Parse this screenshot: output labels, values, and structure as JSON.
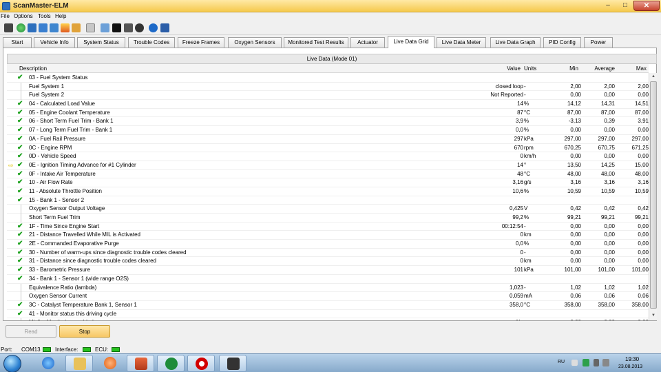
{
  "window": {
    "title": "ScanMaster-ELM",
    "min": "–",
    "max": "□",
    "close": "✕"
  },
  "menu": [
    "File",
    "Options",
    "Tools",
    "Help"
  ],
  "tabs": [
    "Start",
    "Vehicle Info",
    "System Status",
    "Trouble Codes",
    "Freeze Frames",
    "Oxygen Sensors",
    "Monitored Test Results",
    "Actuator",
    "Live Data Grid",
    "Live Data Meter",
    "Live Data Graph",
    "PID Config",
    "Power"
  ],
  "active_tab": "Live Data Grid",
  "panel_title": "Live Data (Mode 01)",
  "columns": {
    "description": "Description",
    "value": "Value",
    "units": "Units",
    "min": "Min",
    "average": "Average",
    "max": "Max"
  },
  "rows": [
    {
      "d": "03 - Fuel System Status",
      "v": "",
      "u": "",
      "mn": "",
      "av": "",
      "mx": "",
      "icon": "check",
      "indent": false
    },
    {
      "d": "Fuel System 1",
      "v": "closed loop",
      "u": "-",
      "mn": "2,00",
      "av": "2,00",
      "mx": "2,00",
      "icon": "",
      "indent": true
    },
    {
      "d": "Fuel System 2",
      "v": "Not Reported",
      "u": "-",
      "mn": "0,00",
      "av": "0,00",
      "mx": "0,00",
      "icon": "",
      "indent": true
    },
    {
      "d": "04 - Calculated Load Value",
      "v": "14",
      "u": "%",
      "mn": "14,12",
      "av": "14,31",
      "mx": "14,51",
      "icon": "check",
      "indent": false
    },
    {
      "d": "05 - Engine Coolant Temperature",
      "v": "87",
      "u": "°C",
      "mn": "87,00",
      "av": "87,00",
      "mx": "87,00",
      "icon": "check",
      "indent": false
    },
    {
      "d": "06 - Short Term Fuel Trim - Bank 1",
      "v": "3,9",
      "u": "%",
      "mn": "-3,13",
      "av": "0,39",
      "mx": "3,91",
      "icon": "check",
      "indent": false
    },
    {
      "d": "07 - Long Term Fuel Trim - Bank 1",
      "v": "0,0",
      "u": "%",
      "mn": "0,00",
      "av": "0,00",
      "mx": "0,00",
      "icon": "check",
      "indent": false
    },
    {
      "d": "0A - Fuel Rail Pressure",
      "v": "297",
      "u": "kPa",
      "mn": "297,00",
      "av": "297,00",
      "mx": "297,00",
      "icon": "check",
      "indent": false
    },
    {
      "d": "0C - Engine RPM",
      "v": "670",
      "u": "rpm",
      "mn": "670,25",
      "av": "670,75",
      "mx": "671,25",
      "icon": "check",
      "indent": false
    },
    {
      "d": "0D - Vehicle Speed",
      "v": "0",
      "u": "km/h",
      "mn": "0,00",
      "av": "0,00",
      "mx": "0,00",
      "icon": "check",
      "indent": false
    },
    {
      "d": "0E - Ignition Timing Advance for #1 Cylinder",
      "v": "14",
      "u": "°",
      "mn": "13,50",
      "av": "14,25",
      "mx": "15,00",
      "icon": "check",
      "indent": false,
      "arrow": "⇨"
    },
    {
      "d": "0F - Intake Air Temperature",
      "v": "48",
      "u": "°C",
      "mn": "48,00",
      "av": "48,00",
      "mx": "48,00",
      "icon": "check",
      "indent": false
    },
    {
      "d": "10 - Air Flow Rate",
      "v": "3,16",
      "u": "g/s",
      "mn": "3,16",
      "av": "3,16",
      "mx": "3,16",
      "icon": "check",
      "indent": false
    },
    {
      "d": "11 - Absolute Throttle Position",
      "v": "10,6",
      "u": "%",
      "mn": "10,59",
      "av": "10,59",
      "mx": "10,59",
      "icon": "check",
      "indent": false
    },
    {
      "d": "15 - Bank 1 - Sensor 2",
      "v": "",
      "u": "",
      "mn": "",
      "av": "",
      "mx": "",
      "icon": "check",
      "indent": false
    },
    {
      "d": "Oxygen Sensor Output Voltage",
      "v": "0,425",
      "u": "V",
      "mn": "0,42",
      "av": "0,42",
      "mx": "0,42",
      "icon": "",
      "indent": true
    },
    {
      "d": "Short Term Fuel Trim",
      "v": "99,2",
      "u": "%",
      "mn": "99,21",
      "av": "99,21",
      "mx": "99,21",
      "icon": "",
      "indent": true
    },
    {
      "d": "1F - Time Since Engine Start",
      "v": "00:12:54",
      "u": "-",
      "mn": "0,00",
      "av": "0,00",
      "mx": "0,00",
      "icon": "check",
      "indent": false
    },
    {
      "d": "21 - Distance Travelled While MIL is Activated",
      "v": "0",
      "u": "km",
      "mn": "0,00",
      "av": "0,00",
      "mx": "0,00",
      "icon": "check",
      "indent": false
    },
    {
      "d": "2E - Commanded Evaporative Purge",
      "v": "0,0",
      "u": "%",
      "mn": "0,00",
      "av": "0,00",
      "mx": "0,00",
      "icon": "check",
      "indent": false
    },
    {
      "d": "30 - Number of warm-ups since diagnostic trouble codes cleared",
      "v": "0",
      "u": "-",
      "mn": "0,00",
      "av": "0,00",
      "mx": "0,00",
      "icon": "check",
      "indent": false
    },
    {
      "d": "31 - Distance since diagnostic trouble codes cleared",
      "v": "0",
      "u": "km",
      "mn": "0,00",
      "av": "0,00",
      "mx": "0,00",
      "icon": "check",
      "indent": false
    },
    {
      "d": "33 - Barometric Pressure",
      "v": "101",
      "u": "kPa",
      "mn": "101,00",
      "av": "101,00",
      "mx": "101,00",
      "icon": "check",
      "indent": false
    },
    {
      "d": "34 - Bank 1 - Sensor 1 (wide range O2S)",
      "v": "",
      "u": "",
      "mn": "",
      "av": "",
      "mx": "",
      "icon": "check",
      "indent": false
    },
    {
      "d": "Equivalence Ratio (lambda)",
      "v": "1,023",
      "u": "-",
      "mn": "1,02",
      "av": "1,02",
      "mx": "1,02",
      "icon": "",
      "indent": true
    },
    {
      "d": "Oxygen Sensor Current",
      "v": "0,059",
      "u": "mA",
      "mn": "0,06",
      "av": "0,06",
      "mx": "0,06",
      "icon": "",
      "indent": true
    },
    {
      "d": "3C - Catalyst Temperature Bank 1, Sensor 1",
      "v": "358,0",
      "u": "°C",
      "mn": "358,00",
      "av": "358,00",
      "mx": "358,00",
      "icon": "check",
      "indent": false
    },
    {
      "d": "41 - Monitor status this driving cycle",
      "v": "",
      "u": "",
      "mn": "",
      "av": "",
      "mx": "",
      "icon": "check",
      "indent": false
    },
    {
      "d": "Misfire Monitoring enabled",
      "v": "No",
      "u": "-",
      "mn": "0,00",
      "av": "0,00",
      "mx": "0,00",
      "icon": "",
      "indent": true
    }
  ],
  "buttons": {
    "read": "Read",
    "stop": "Stop"
  },
  "status": {
    "port_label": "Port:",
    "port": "COM13",
    "interface_label": "Interface:",
    "ecu_label": "ECU:"
  },
  "tray": {
    "lang": "RU",
    "time": "19:30",
    "date": "23.08.2013"
  },
  "colors": {
    "accent": "#f5c94c",
    "check": "#19a01a",
    "led": "#26c11e"
  }
}
